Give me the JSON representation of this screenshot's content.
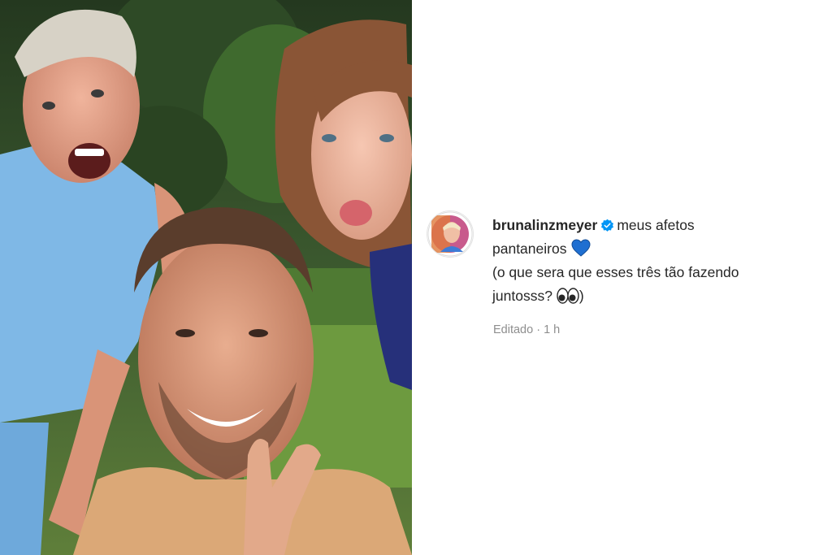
{
  "post": {
    "image": {
      "description_icon": "photo-image"
    },
    "author": {
      "username": "brunalinzmeyer",
      "verified": true,
      "avatar_icon": "avatar-icon"
    },
    "caption": {
      "line1": "meus afetos",
      "line2": "pantaneiros",
      "line2_emoji_icon": "blue-heart-icon",
      "line3": "(o que sera que esses três tão fazendo",
      "line4_before": "juntosss?",
      "line4_emoji_icon": "eyes-icon",
      "line4_after": ")"
    },
    "meta": {
      "edited_label": "Editado",
      "separator": "·",
      "time": "1 h"
    }
  },
  "colors": {
    "text": "#262626",
    "muted": "#8e8e8e",
    "verified_blue": "#0095f6",
    "heart_blue": "#1f6fd1"
  }
}
